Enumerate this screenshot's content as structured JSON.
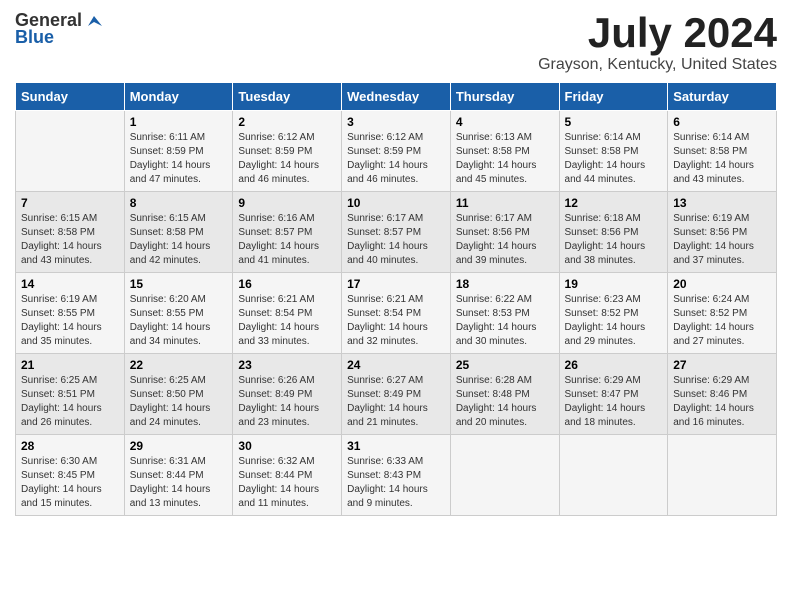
{
  "header": {
    "logo_general": "General",
    "logo_blue": "Blue",
    "month_title": "July 2024",
    "location": "Grayson, Kentucky, United States"
  },
  "calendar": {
    "weekdays": [
      "Sunday",
      "Monday",
      "Tuesday",
      "Wednesday",
      "Thursday",
      "Friday",
      "Saturday"
    ],
    "weeks": [
      [
        {
          "day": "",
          "sunrise": "",
          "sunset": "",
          "daylight": ""
        },
        {
          "day": "1",
          "sunrise": "Sunrise: 6:11 AM",
          "sunset": "Sunset: 8:59 PM",
          "daylight": "Daylight: 14 hours and 47 minutes."
        },
        {
          "day": "2",
          "sunrise": "Sunrise: 6:12 AM",
          "sunset": "Sunset: 8:59 PM",
          "daylight": "Daylight: 14 hours and 46 minutes."
        },
        {
          "day": "3",
          "sunrise": "Sunrise: 6:12 AM",
          "sunset": "Sunset: 8:59 PM",
          "daylight": "Daylight: 14 hours and 46 minutes."
        },
        {
          "day": "4",
          "sunrise": "Sunrise: 6:13 AM",
          "sunset": "Sunset: 8:58 PM",
          "daylight": "Daylight: 14 hours and 45 minutes."
        },
        {
          "day": "5",
          "sunrise": "Sunrise: 6:14 AM",
          "sunset": "Sunset: 8:58 PM",
          "daylight": "Daylight: 14 hours and 44 minutes."
        },
        {
          "day": "6",
          "sunrise": "Sunrise: 6:14 AM",
          "sunset": "Sunset: 8:58 PM",
          "daylight": "Daylight: 14 hours and 43 minutes."
        }
      ],
      [
        {
          "day": "7",
          "sunrise": "Sunrise: 6:15 AM",
          "sunset": "Sunset: 8:58 PM",
          "daylight": "Daylight: 14 hours and 43 minutes."
        },
        {
          "day": "8",
          "sunrise": "Sunrise: 6:15 AM",
          "sunset": "Sunset: 8:58 PM",
          "daylight": "Daylight: 14 hours and 42 minutes."
        },
        {
          "day": "9",
          "sunrise": "Sunrise: 6:16 AM",
          "sunset": "Sunset: 8:57 PM",
          "daylight": "Daylight: 14 hours and 41 minutes."
        },
        {
          "day": "10",
          "sunrise": "Sunrise: 6:17 AM",
          "sunset": "Sunset: 8:57 PM",
          "daylight": "Daylight: 14 hours and 40 minutes."
        },
        {
          "day": "11",
          "sunrise": "Sunrise: 6:17 AM",
          "sunset": "Sunset: 8:56 PM",
          "daylight": "Daylight: 14 hours and 39 minutes."
        },
        {
          "day": "12",
          "sunrise": "Sunrise: 6:18 AM",
          "sunset": "Sunset: 8:56 PM",
          "daylight": "Daylight: 14 hours and 38 minutes."
        },
        {
          "day": "13",
          "sunrise": "Sunrise: 6:19 AM",
          "sunset": "Sunset: 8:56 PM",
          "daylight": "Daylight: 14 hours and 37 minutes."
        }
      ],
      [
        {
          "day": "14",
          "sunrise": "Sunrise: 6:19 AM",
          "sunset": "Sunset: 8:55 PM",
          "daylight": "Daylight: 14 hours and 35 minutes."
        },
        {
          "day": "15",
          "sunrise": "Sunrise: 6:20 AM",
          "sunset": "Sunset: 8:55 PM",
          "daylight": "Daylight: 14 hours and 34 minutes."
        },
        {
          "day": "16",
          "sunrise": "Sunrise: 6:21 AM",
          "sunset": "Sunset: 8:54 PM",
          "daylight": "Daylight: 14 hours and 33 minutes."
        },
        {
          "day": "17",
          "sunrise": "Sunrise: 6:21 AM",
          "sunset": "Sunset: 8:54 PM",
          "daylight": "Daylight: 14 hours and 32 minutes."
        },
        {
          "day": "18",
          "sunrise": "Sunrise: 6:22 AM",
          "sunset": "Sunset: 8:53 PM",
          "daylight": "Daylight: 14 hours and 30 minutes."
        },
        {
          "day": "19",
          "sunrise": "Sunrise: 6:23 AM",
          "sunset": "Sunset: 8:52 PM",
          "daylight": "Daylight: 14 hours and 29 minutes."
        },
        {
          "day": "20",
          "sunrise": "Sunrise: 6:24 AM",
          "sunset": "Sunset: 8:52 PM",
          "daylight": "Daylight: 14 hours and 27 minutes."
        }
      ],
      [
        {
          "day": "21",
          "sunrise": "Sunrise: 6:25 AM",
          "sunset": "Sunset: 8:51 PM",
          "daylight": "Daylight: 14 hours and 26 minutes."
        },
        {
          "day": "22",
          "sunrise": "Sunrise: 6:25 AM",
          "sunset": "Sunset: 8:50 PM",
          "daylight": "Daylight: 14 hours and 24 minutes."
        },
        {
          "day": "23",
          "sunrise": "Sunrise: 6:26 AM",
          "sunset": "Sunset: 8:49 PM",
          "daylight": "Daylight: 14 hours and 23 minutes."
        },
        {
          "day": "24",
          "sunrise": "Sunrise: 6:27 AM",
          "sunset": "Sunset: 8:49 PM",
          "daylight": "Daylight: 14 hours and 21 minutes."
        },
        {
          "day": "25",
          "sunrise": "Sunrise: 6:28 AM",
          "sunset": "Sunset: 8:48 PM",
          "daylight": "Daylight: 14 hours and 20 minutes."
        },
        {
          "day": "26",
          "sunrise": "Sunrise: 6:29 AM",
          "sunset": "Sunset: 8:47 PM",
          "daylight": "Daylight: 14 hours and 18 minutes."
        },
        {
          "day": "27",
          "sunrise": "Sunrise: 6:29 AM",
          "sunset": "Sunset: 8:46 PM",
          "daylight": "Daylight: 14 hours and 16 minutes."
        }
      ],
      [
        {
          "day": "28",
          "sunrise": "Sunrise: 6:30 AM",
          "sunset": "Sunset: 8:45 PM",
          "daylight": "Daylight: 14 hours and 15 minutes."
        },
        {
          "day": "29",
          "sunrise": "Sunrise: 6:31 AM",
          "sunset": "Sunset: 8:44 PM",
          "daylight": "Daylight: 14 hours and 13 minutes."
        },
        {
          "day": "30",
          "sunrise": "Sunrise: 6:32 AM",
          "sunset": "Sunset: 8:44 PM",
          "daylight": "Daylight: 14 hours and 11 minutes."
        },
        {
          "day": "31",
          "sunrise": "Sunrise: 6:33 AM",
          "sunset": "Sunset: 8:43 PM",
          "daylight": "Daylight: 14 hours and 9 minutes."
        },
        {
          "day": "",
          "sunrise": "",
          "sunset": "",
          "daylight": ""
        },
        {
          "day": "",
          "sunrise": "",
          "sunset": "",
          "daylight": ""
        },
        {
          "day": "",
          "sunrise": "",
          "sunset": "",
          "daylight": ""
        }
      ]
    ]
  }
}
